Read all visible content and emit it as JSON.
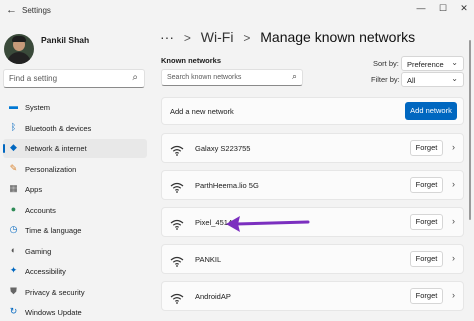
{
  "window": {
    "title": "Settings",
    "back_glyph": "←",
    "controls": {
      "minimize": "—",
      "maximize": "☐",
      "close": "✕"
    }
  },
  "profile": {
    "name": "Pankil Shah"
  },
  "sidebar": {
    "search_placeholder": "Find a setting",
    "items": [
      {
        "label": "System",
        "icon": "system-icon",
        "glyph": "▬",
        "color": "#0078d4"
      },
      {
        "label": "Bluetooth & devices",
        "icon": "bluetooth-icon",
        "glyph": "ᛒ",
        "color": "#0067c0"
      },
      {
        "label": "Network & internet",
        "icon": "network-icon",
        "glyph": "◆",
        "color": "#0067c0",
        "selected": true
      },
      {
        "label": "Personalization",
        "icon": "personalization-icon",
        "glyph": "✎",
        "color": "#d9822b"
      },
      {
        "label": "Apps",
        "icon": "apps-icon",
        "glyph": "▦",
        "color": "#555555"
      },
      {
        "label": "Accounts",
        "icon": "accounts-icon",
        "glyph": "●",
        "color": "#2e8b57"
      },
      {
        "label": "Time & language",
        "icon": "time-language-icon",
        "glyph": "◷",
        "color": "#0067c0"
      },
      {
        "label": "Gaming",
        "icon": "gaming-icon",
        "glyph": "◐",
        "color": "#555555"
      },
      {
        "label": "Accessibility",
        "icon": "accessibility-icon",
        "glyph": "✦",
        "color": "#0067c0"
      },
      {
        "label": "Privacy & security",
        "icon": "privacy-security-icon",
        "glyph": "⛊",
        "color": "#666666"
      },
      {
        "label": "Windows Update",
        "icon": "windows-update-icon",
        "glyph": "↻",
        "color": "#0067c0"
      }
    ]
  },
  "breadcrumb": {
    "more": "···",
    "parent": "Wi-Fi",
    "separator": ">",
    "current": "Manage known networks"
  },
  "known_networks": {
    "label": "Known networks",
    "search_placeholder": "Search known networks",
    "sort_label": "Sort by:",
    "sort_value": "Preference",
    "filter_label": "Filter by:",
    "filter_value": "All",
    "add_label": "Add a new network",
    "add_button": "Add network",
    "forget_label": "Forget",
    "networks": [
      {
        "name": "Galaxy S223755"
      },
      {
        "name": "ParthHeema.lio 5G"
      },
      {
        "name": "Pixel_4514"
      },
      {
        "name": "PANKIL"
      },
      {
        "name": "AndroidAP"
      }
    ]
  },
  "colors": {
    "accent": "#0067c0",
    "annotation_arrow": "#7b2fbf"
  }
}
